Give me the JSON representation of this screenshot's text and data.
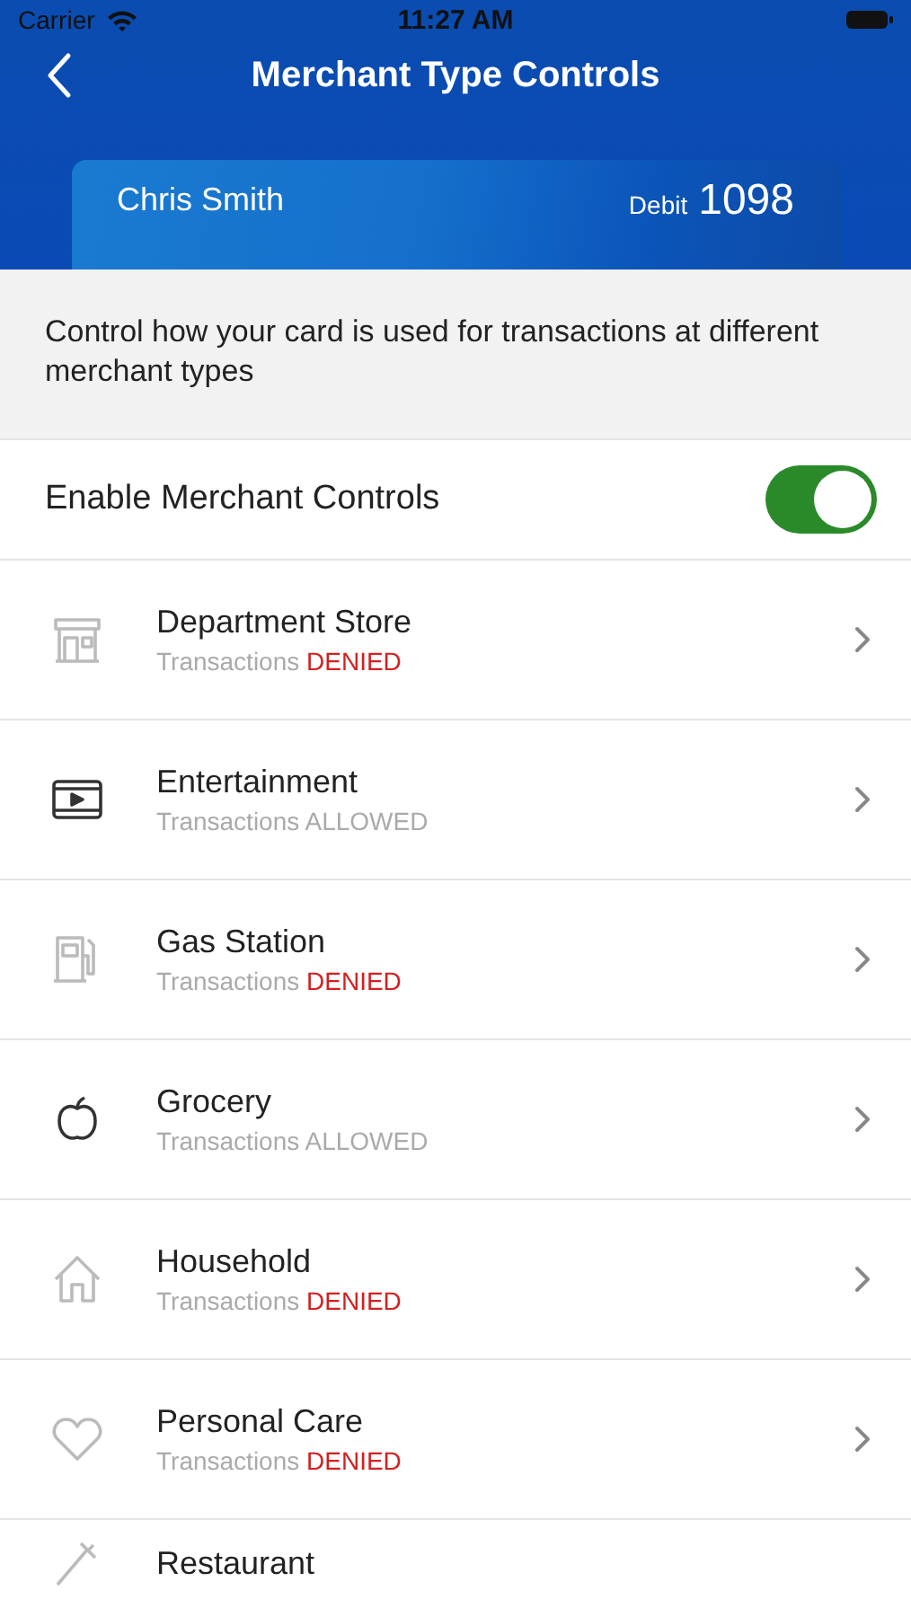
{
  "status_bar": {
    "carrier": "Carrier",
    "time": "11:27 AM"
  },
  "nav": {
    "title": "Merchant Type Controls"
  },
  "card": {
    "holder": "Chris Smith",
    "type": "Debit",
    "number": "1098"
  },
  "description": "Control how your card is used for transactions at different merchant types",
  "master_toggle": {
    "label": "Enable Merchant Controls",
    "on": true
  },
  "merchants": [
    {
      "kind": "store",
      "name": "Department Store",
      "prefix": "Transactions",
      "status": "DENIED",
      "allowed": false
    },
    {
      "kind": "film",
      "name": "Entertainment",
      "prefix": "Transactions",
      "status": "ALLOWED",
      "allowed": true
    },
    {
      "kind": "fuel",
      "name": "Gas Station",
      "prefix": "Transactions",
      "status": "DENIED",
      "allowed": false
    },
    {
      "kind": "apple",
      "name": "Grocery",
      "prefix": "Transactions",
      "status": "ALLOWED",
      "allowed": true
    },
    {
      "kind": "house",
      "name": "Household",
      "prefix": "Transactions",
      "status": "DENIED",
      "allowed": false
    },
    {
      "kind": "heart",
      "name": "Personal Care",
      "prefix": "Transactions",
      "status": "DENIED",
      "allowed": false
    },
    {
      "kind": "fork",
      "name": "Restaurant"
    }
  ]
}
